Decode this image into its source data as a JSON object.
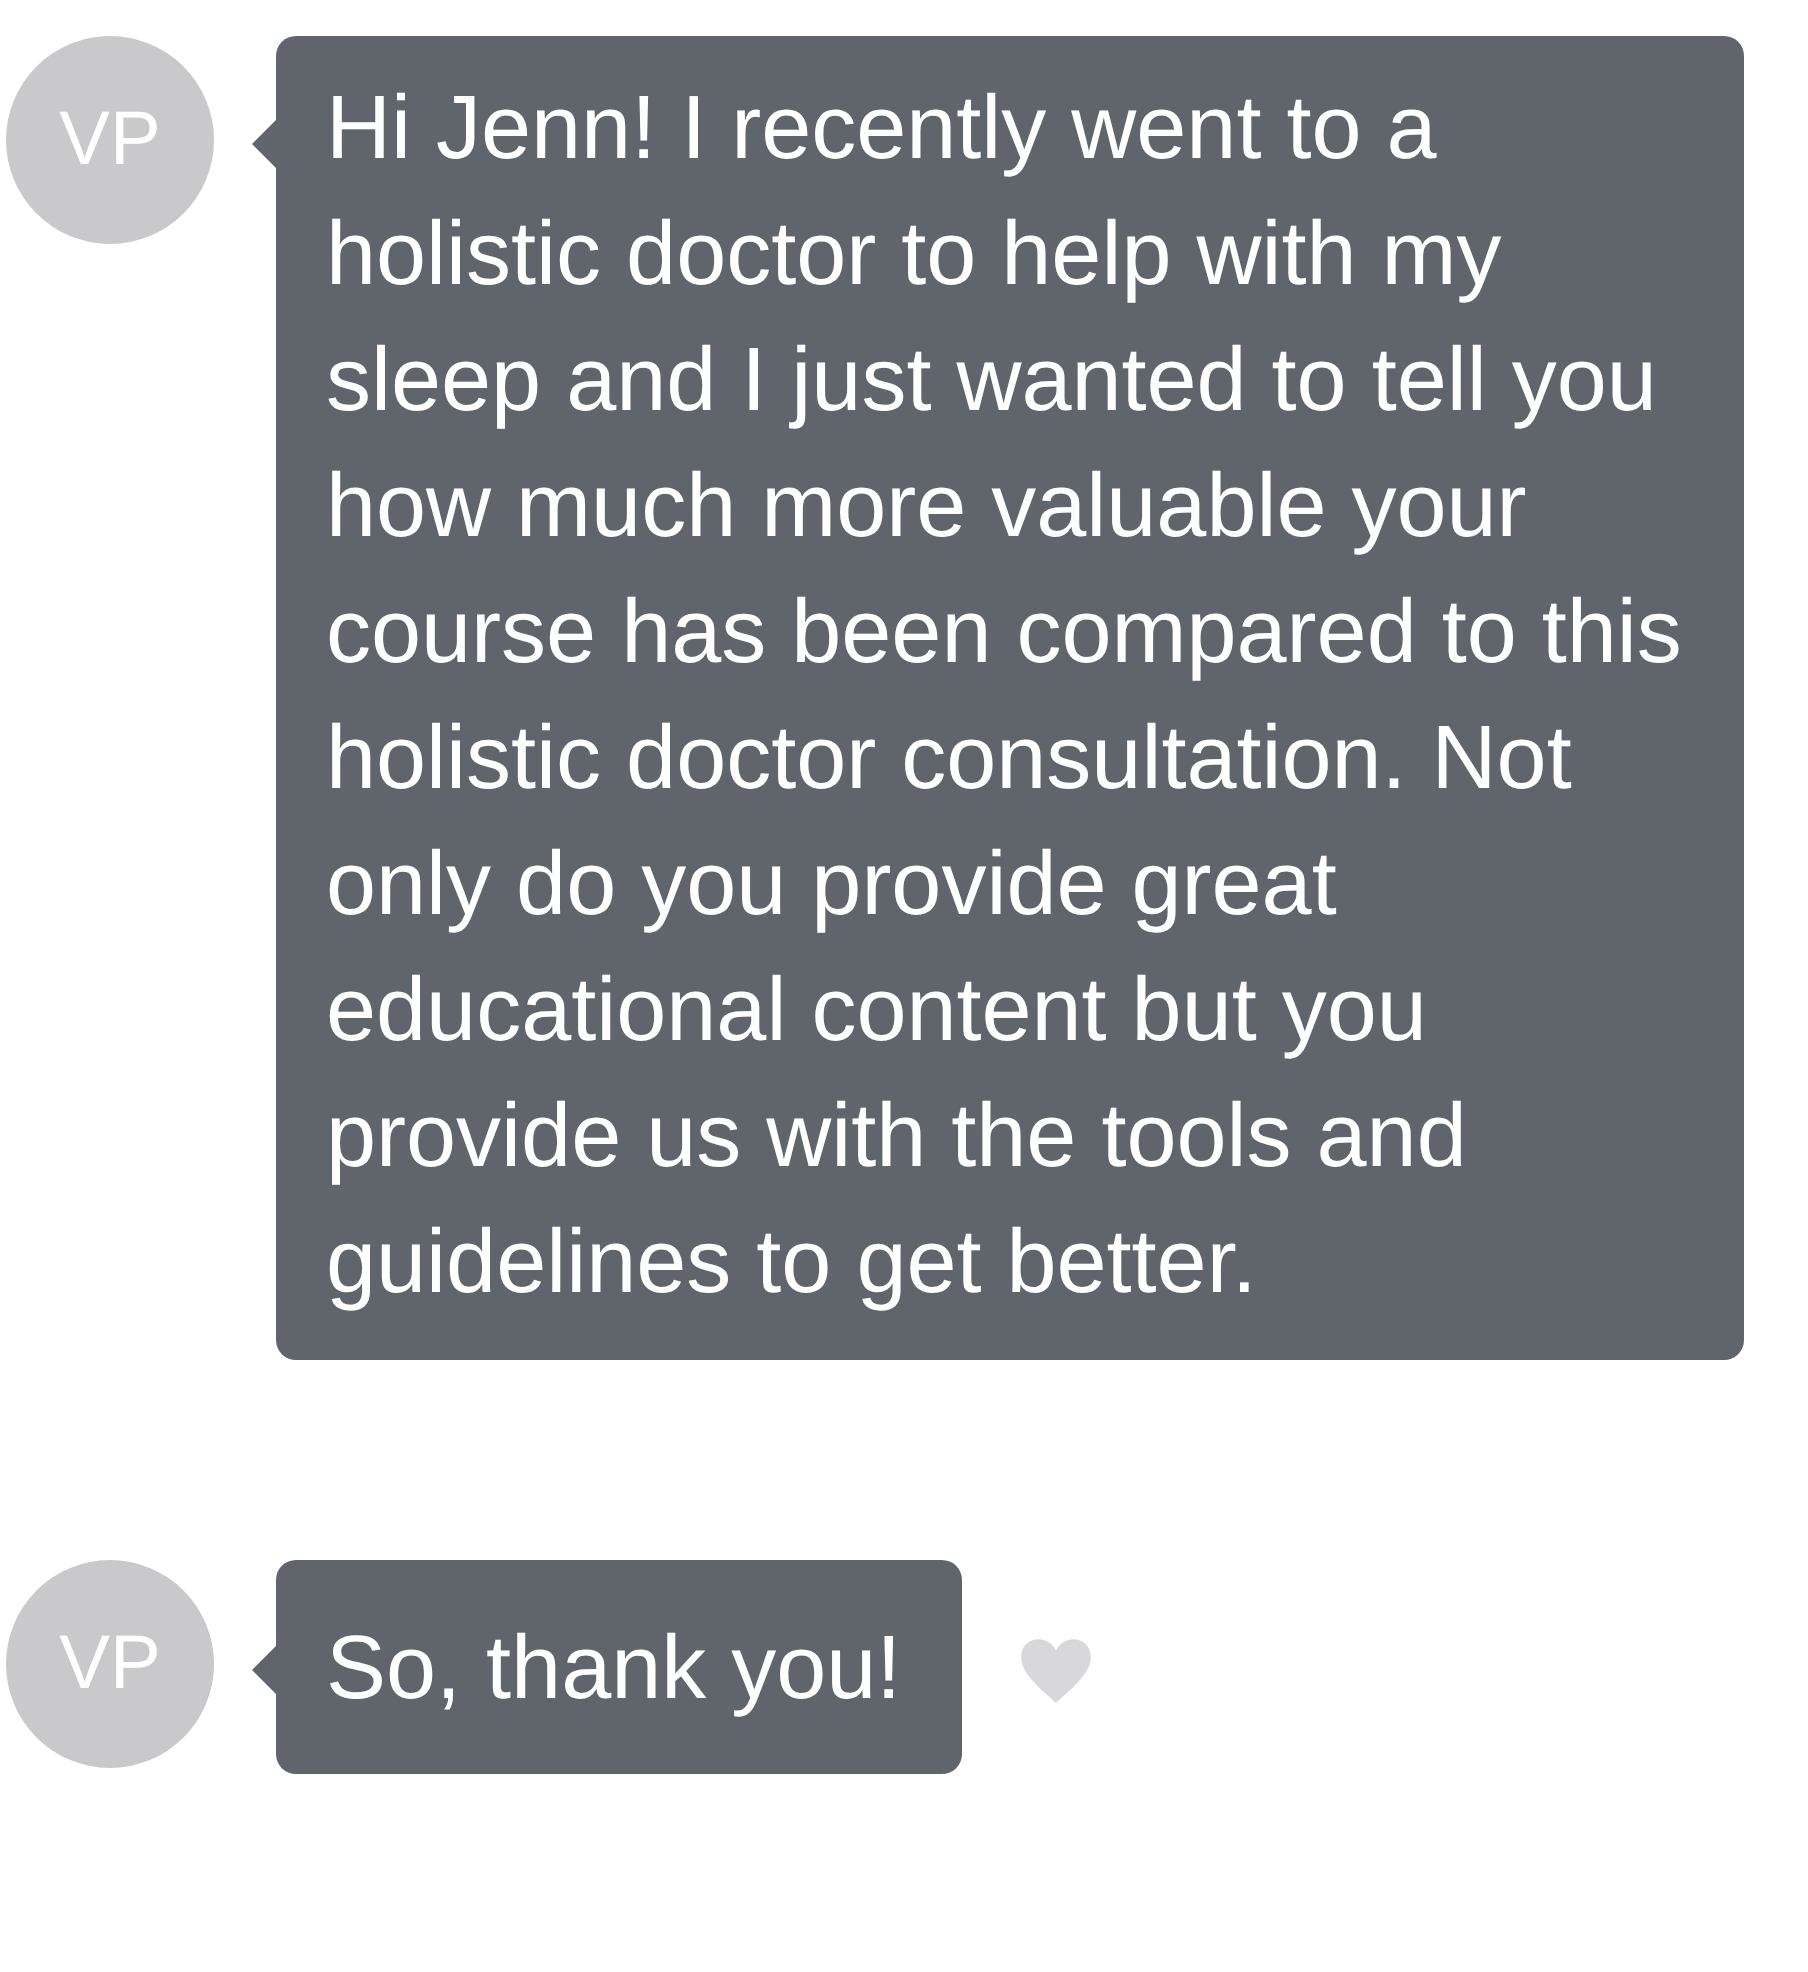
{
  "messages": [
    {
      "avatar": "VP",
      "text": "Hi Jenn! I recently went to a holistic doctor to help with my sleep and I just wanted to tell you how much more valuable your course has been compared to this holistic doctor consultation. Not only do you provide great educational content but you provide us with the tools and guidelines to get better."
    },
    {
      "avatar": "VP",
      "text": "So, thank you!",
      "heart": {
        "selected": false
      }
    }
  ]
}
